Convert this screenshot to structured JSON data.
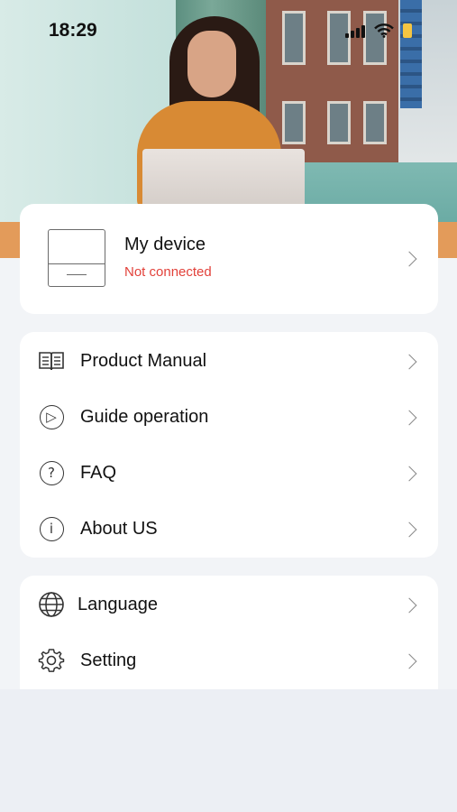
{
  "status_bar": {
    "time": "18:29"
  },
  "device_card": {
    "name": "My device",
    "status": "Not connected",
    "status_color": "#e2413a"
  },
  "menu_group_1": {
    "items": [
      {
        "label": "Product Manual",
        "icon": "book-icon"
      },
      {
        "label": "Guide operation",
        "icon": "play-circle-icon"
      },
      {
        "label": "FAQ",
        "icon": "question-circle-icon"
      },
      {
        "label": "About US",
        "icon": "info-circle-icon"
      }
    ]
  },
  "menu_group_2": {
    "items": [
      {
        "label": "Language",
        "icon": "globe-icon"
      },
      {
        "label": "Setting",
        "icon": "gear-icon"
      }
    ]
  },
  "icons": {
    "play": "▷",
    "question": "?",
    "info": "i"
  },
  "colors": {
    "page_background": "#eceff4",
    "card_background": "#ffffff",
    "chevron": "#8a8a8a"
  }
}
